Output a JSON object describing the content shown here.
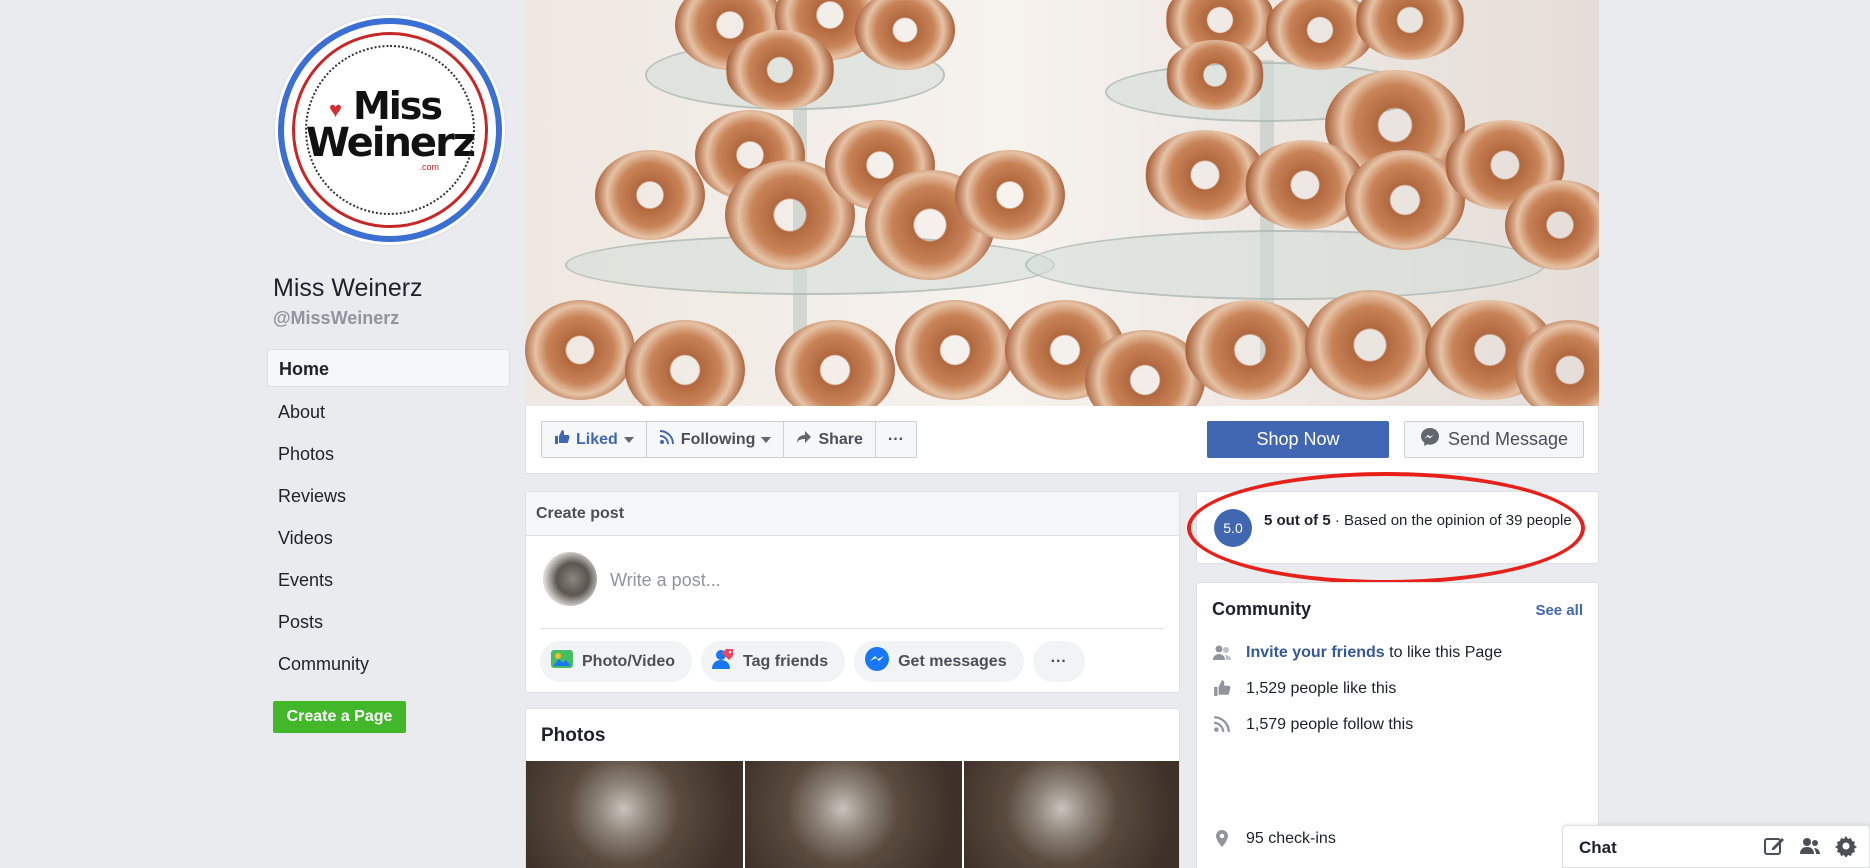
{
  "page": {
    "name": "Miss Weinerz",
    "handle": "@MissWeinerz",
    "logo": {
      "line1": "Miss",
      "line2": "Weinerz",
      "suffix": ".com"
    }
  },
  "sidebar": {
    "items": [
      {
        "label": "Home",
        "active": true
      },
      {
        "label": "About"
      },
      {
        "label": "Photos"
      },
      {
        "label": "Reviews"
      },
      {
        "label": "Videos"
      },
      {
        "label": "Events"
      },
      {
        "label": "Posts"
      },
      {
        "label": "Community"
      }
    ],
    "create_page": "Create a Page"
  },
  "actions": {
    "liked": "Liked",
    "following": "Following",
    "share": "Share",
    "more": "···",
    "shop_now": "Shop Now",
    "send_message": "Send Message"
  },
  "create_post": {
    "header": "Create post",
    "placeholder": "Write a post...",
    "buttons": {
      "photo_video": "Photo/Video",
      "tag_friends": "Tag friends",
      "get_messages": "Get messages",
      "more": "···"
    }
  },
  "photos": {
    "title": "Photos"
  },
  "rating": {
    "badge": "5.0",
    "bold": "5 out of 5",
    "rest": " · Based on the opinion of 39 people"
  },
  "community": {
    "title": "Community",
    "see_all": "See all",
    "invite_link": "Invite your friends",
    "invite_rest": " to like this Page",
    "likes": "1,529 people like this",
    "follows": "1,579 people follow this",
    "checkins": "95 check-ins"
  },
  "chat": {
    "label": "Chat"
  },
  "colors": {
    "brand_blue": "#4267b2",
    "green": "#42b72a",
    "highlight_red": "#e8201a"
  }
}
